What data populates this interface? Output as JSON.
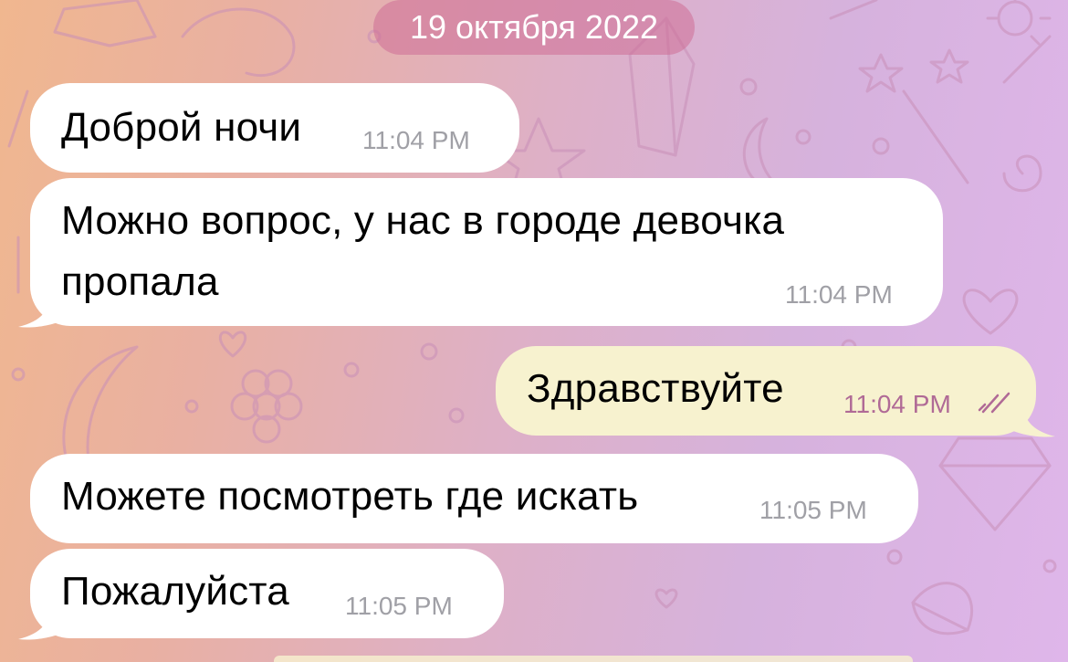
{
  "chat": {
    "date_separator": "19 октября 2022",
    "messages": [
      {
        "direction": "incoming",
        "text": "Доброй ночи",
        "time": "11:04 PM"
      },
      {
        "direction": "incoming",
        "text_line1": "Можно вопрос, у нас в городе девочка",
        "text_line2": "пропала",
        "time": "11:04 PM"
      },
      {
        "direction": "outgoing",
        "text": "Здравствуйте",
        "time": "11:04 PM",
        "status": "read",
        "status_icon": "double-check-icon"
      },
      {
        "direction": "incoming",
        "text": "Можете посмотреть где искать",
        "time": "11:05 PM"
      },
      {
        "direction": "incoming",
        "text": "Пожалуйста",
        "time": "11:05 PM"
      }
    ]
  },
  "colors": {
    "incoming_bubble": "#ffffff",
    "outgoing_bubble": "#f7f2cf",
    "outgoing_time": "#b06a96",
    "incoming_time": "#a0a0a6",
    "date_pill": "#cd6e96"
  }
}
